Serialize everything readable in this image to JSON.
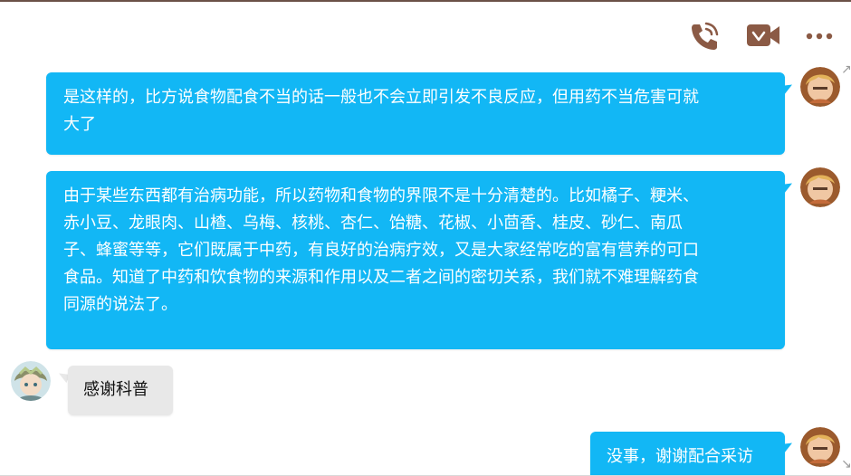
{
  "toolbar": {
    "voice_call_icon": "phone-icon",
    "video_call_icon": "video-camera-icon",
    "more_icon": "more-dots-icon",
    "icon_color": "#8b5a45"
  },
  "colors": {
    "outgoing_bubble": "#12b7f5",
    "incoming_bubble": "#e8e8e8"
  },
  "messages": [
    {
      "direction": "outgoing",
      "lines": [
        "是这样的，比方说食物配食不当的话一般也不会立即引发不良反应，但用药不当危害可就",
        "大了"
      ]
    },
    {
      "direction": "outgoing",
      "lines": [
        "由于某些东西都有治病功能，所以药物和食物的界限不是十分清楚的。比如橘子、粳米、",
        "赤小豆、龙眼肉、山楂、乌梅、核桃、杏仁、饴糖、花椒、小茴香、桂皮、砂仁、南瓜",
        "子、蜂蜜等等，它们既属于中药，有良好的治病疗效，又是大家经常吃的富有营养的可口",
        "食品。知道了中药和饮食物的来源和作用以及二者之间的密切关系，我们就不难理解药食",
        "同源的说法了。"
      ]
    },
    {
      "direction": "incoming",
      "lines": [
        "感谢科普"
      ]
    },
    {
      "direction": "outgoing",
      "lines": [
        "没事，谢谢配合采访"
      ]
    }
  ]
}
